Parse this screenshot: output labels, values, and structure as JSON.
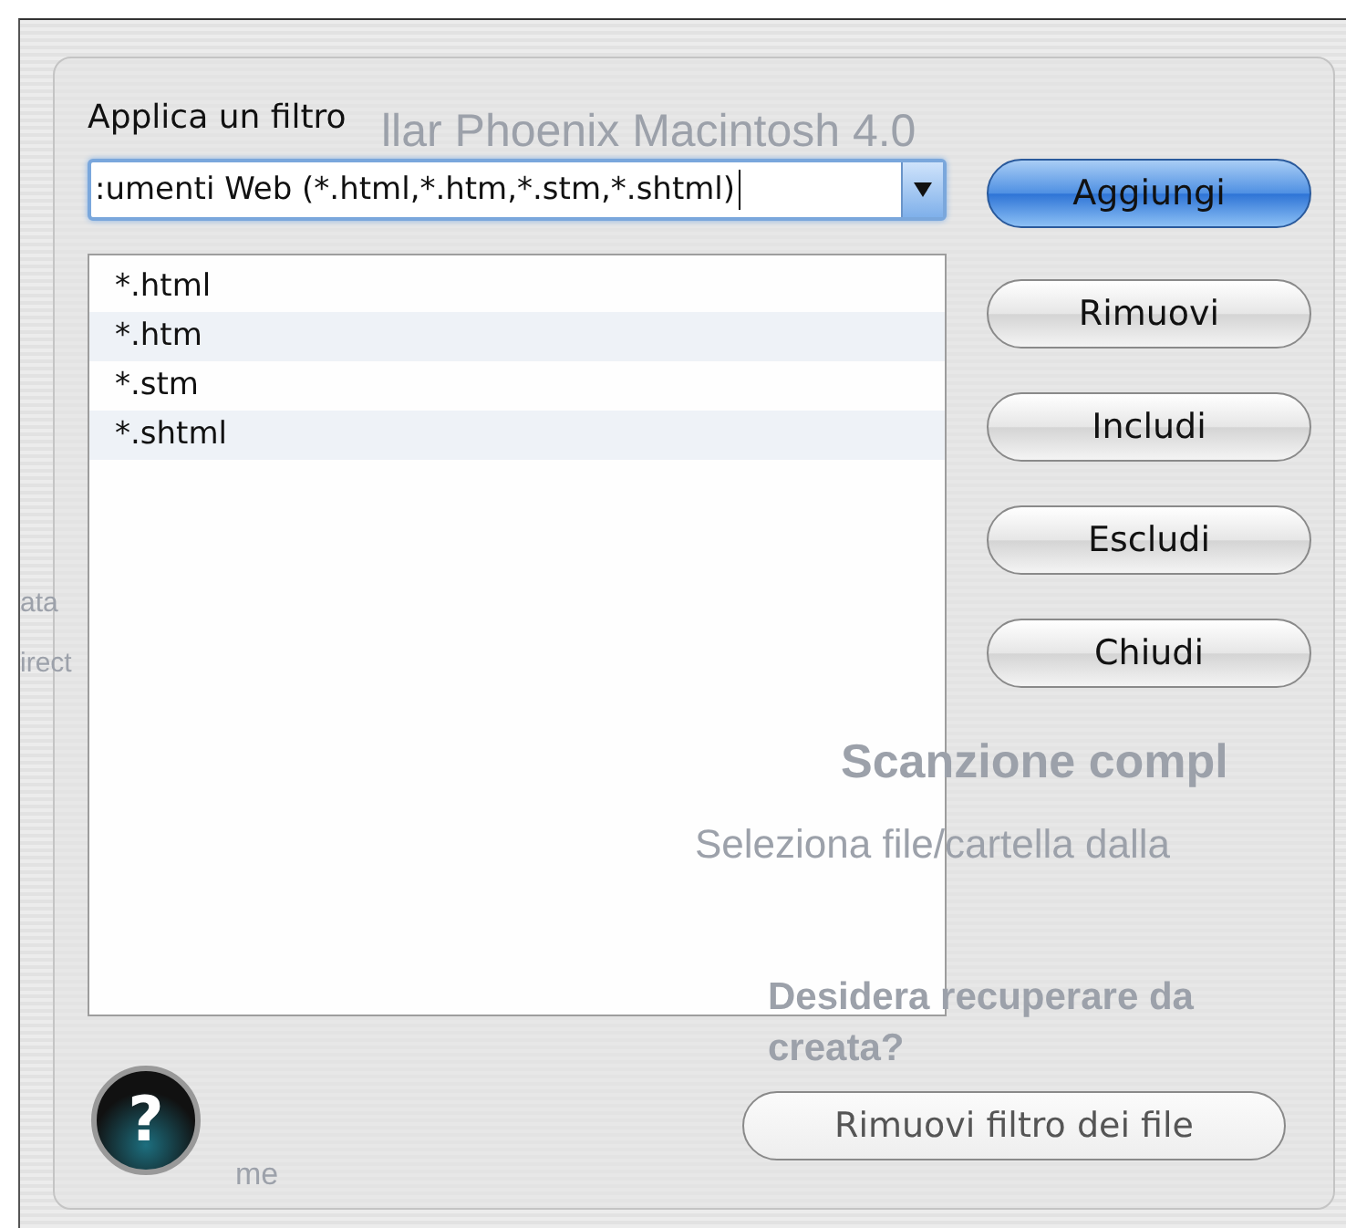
{
  "background_texts": [
    "llar Phoenix Macintosh 4.0",
    "ata",
    "irect",
    "Scanzione compl",
    "Seleziona file/cartella dalla",
    "Desidera recuperare da",
    "creata?",
    "me"
  ],
  "dialog": {
    "title": "Applica un filtro",
    "filter_combo": {
      "value": ":umenti Web (*.html,*.htm,*.stm,*.shtml)"
    },
    "patterns": [
      {
        "label": "*.html",
        "selected": false
      },
      {
        "label": "*.htm",
        "selected": false
      },
      {
        "label": "*.stm",
        "selected": false
      },
      {
        "label": "*.shtml",
        "selected": false
      }
    ],
    "buttons": [
      {
        "label": "Aggiungi",
        "default": true
      },
      {
        "label": "Rimuovi",
        "default": false
      },
      {
        "label": "Includi",
        "default": false
      },
      {
        "label": "Escludi",
        "default": false
      },
      {
        "label": "Chiudi",
        "default": false
      }
    ],
    "help_button": {
      "label": "?"
    },
    "remove_filter_button": {
      "label": "Rimuovi filtro dei file",
      "disabled": true
    }
  }
}
